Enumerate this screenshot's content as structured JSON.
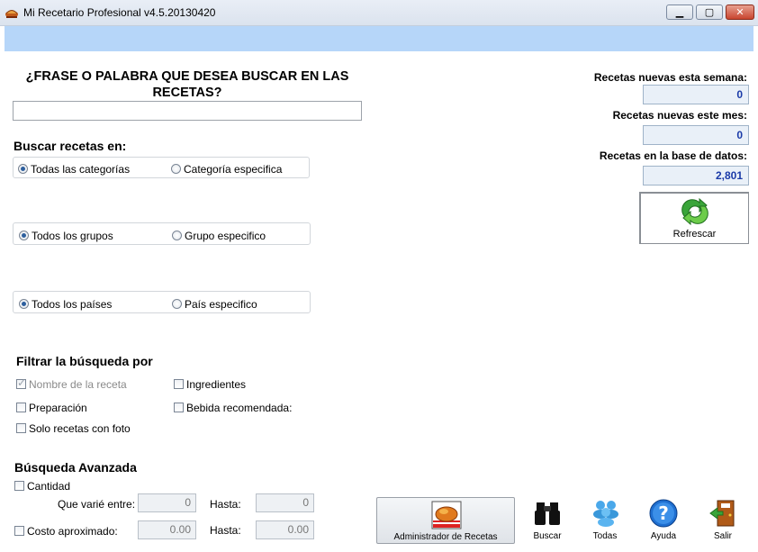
{
  "window": {
    "title": "Mi Recetario Profesional v4.5.20130420"
  },
  "search": {
    "heading": "¿FRASE O PALABRA QUE DESEA BUSCAR EN LAS RECETAS?",
    "value": "",
    "placeholder": ""
  },
  "scope": {
    "title": "Buscar recetas en:",
    "categories": {
      "all": "Todas las categorías",
      "specific": "Categoría especifica",
      "selected": "all"
    },
    "groups": {
      "all": "Todos los grupos",
      "specific": "Grupo especifico",
      "selected": "all"
    },
    "countries": {
      "all": "Todos los países",
      "specific": "País especifico",
      "selected": "all"
    }
  },
  "filter": {
    "title": "Filtrar la búsqueda por",
    "recipe_name": {
      "label": "Nombre de la receta",
      "checked": true,
      "disabled": true
    },
    "ingredients": {
      "label": "Ingredientes",
      "checked": false
    },
    "preparation": {
      "label": "Preparación",
      "checked": false
    },
    "recommended_drink": {
      "label": "Bebida recomendada:",
      "checked": false
    },
    "photo_only": {
      "label": "Solo recetas con foto",
      "checked": false
    }
  },
  "advanced": {
    "title": "Búsqueda Avanzada",
    "quantity": {
      "label": "Cantidad",
      "checked": false
    },
    "range_label": "Que varié entre:",
    "qty_from": "0",
    "to_label": "Hasta:",
    "qty_to": "0",
    "cost": {
      "label": "Costo aproximado:",
      "checked": false
    },
    "cost_from": "0.00",
    "cost_to": "0.00"
  },
  "stats": {
    "new_week_label": "Recetas nuevas esta semana:",
    "new_week": "0",
    "new_month_label": "Recetas nuevas este mes:",
    "new_month": "0",
    "total_label": "Recetas en la base de datos:",
    "total": "2,801"
  },
  "refresh": {
    "label": "Refrescar"
  },
  "toolbar": {
    "admin": "Administrador de Recetas",
    "search": "Buscar",
    "all": "Todas",
    "help": "Ayuda",
    "exit": "Salir"
  },
  "colors": {
    "header_band": "#b6d6f9",
    "stat_value": "#1a3aa8",
    "title_bar": "#dbe3ee"
  }
}
